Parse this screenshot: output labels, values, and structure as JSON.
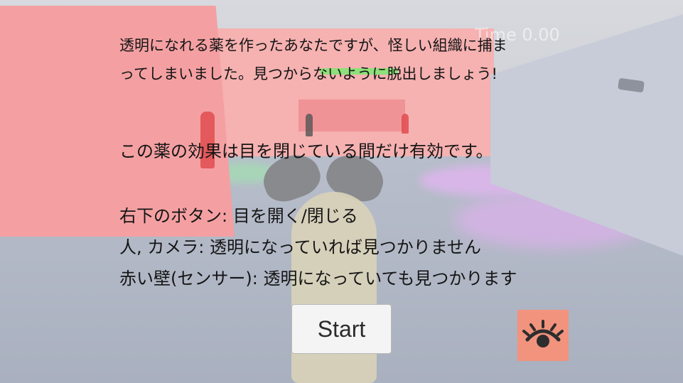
{
  "hud": {
    "timer_text": "Time 0.00"
  },
  "instructions": {
    "intro_line1": "透明になれる薬を作ったあなたですが、怪しい組織に捕ま",
    "intro_line2": "ってしまいました。見つからないように脱出しましょう!",
    "effect": "この薬の効果は目を閉じている間だけ有効です。",
    "rules": [
      "右下のボタン: 目を開く/閉じる",
      "人, カメラ: 透明になっていれば見つかりません",
      "赤い壁(センサー): 透明になっていても見つかります"
    ]
  },
  "start_button": {
    "label": "Start"
  },
  "eye_toggle": {
    "icon": "eye-icon",
    "color": "#f2937e"
  }
}
